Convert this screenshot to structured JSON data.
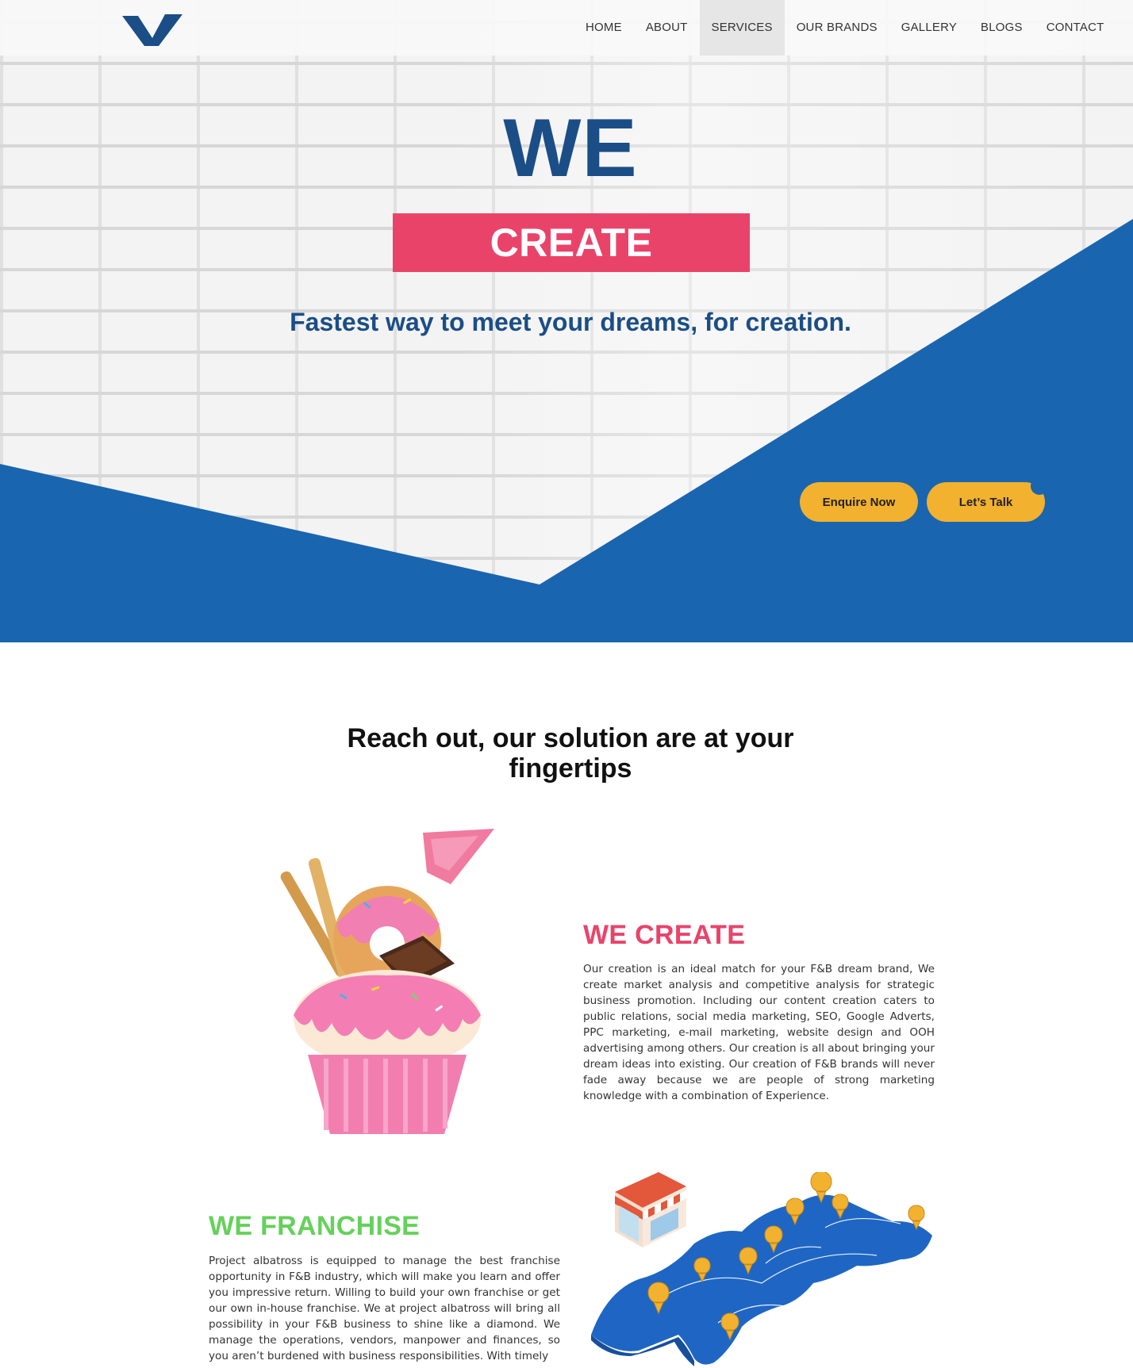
{
  "nav": {
    "items": [
      {
        "label": "HOME",
        "active": false
      },
      {
        "label": "ABOUT",
        "active": false
      },
      {
        "label": "SERVICES",
        "active": true
      },
      {
        "label": "OUR BRANDS",
        "active": false
      },
      {
        "label": "GALLERY",
        "active": false
      },
      {
        "label": "BLOGS",
        "active": false
      },
      {
        "label": "CONTACT",
        "active": false
      }
    ],
    "logo_icon": "checkmark-logo-icon"
  },
  "hero": {
    "headline": "WE",
    "highlight": "CREATE",
    "tagline": "Fastest way to meet your dreams, for creation.",
    "buttons": {
      "enquire": "Enquire Now",
      "talk": "Let’s Talk"
    }
  },
  "solutions": {
    "title_line1": "Reach out, our solution are at your",
    "title_line2": "fingertips"
  },
  "services": {
    "create": {
      "title": "WE CREATE",
      "text": "Our creation is an ideal match for your F&B dream brand, We create market analysis and competitive analysis for strategic business promotion. Including our content creation caters to public relations, social media marketing, SEO, Google Adverts, PPC marketing, e-mail marketing, website design and OOH advertising among others. Our creation is all about bringing your dream ideas into existing. Our creation of F&B brands will never fade away because we are people of strong marketing knowledge with a combination of Experience.",
      "image": "cupcake-donut-illustration"
    },
    "franchise": {
      "title": "WE FRANCHISE",
      "text": "Project albatross is equipped to manage the best franchise opportunity in F&B industry, which will make you learn and offer you impressive return. Willing to build your own franchise or get our own in-house franchise. We at project albatross will bring all possibility in your F&B business to shine like a diamond. We manage the operations, vendors, manpower and finances, so you aren’t burdened with business responsibilities. With timely",
      "image": "world-map-store-illustration"
    }
  },
  "colors": {
    "brand_blue": "#1b4e86",
    "hero_blue": "#1a65b0",
    "accent_pink": "#ea436a",
    "accent_yellow": "#f2b12f",
    "accent_green": "#66d05c"
  }
}
